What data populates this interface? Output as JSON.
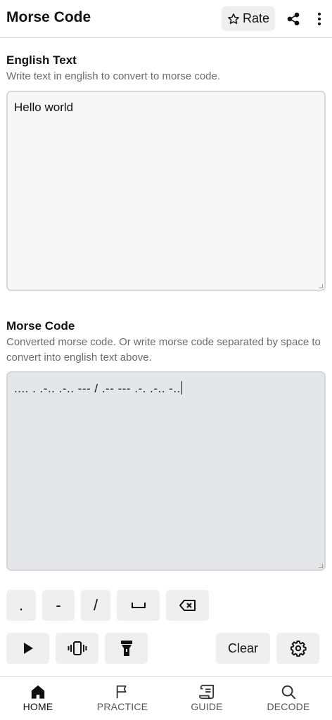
{
  "header": {
    "title": "Morse Code",
    "rate_label": "Rate"
  },
  "english": {
    "title": "English Text",
    "description": "Write text in english to convert to morse code.",
    "value": "Hello world"
  },
  "morse": {
    "title": "Morse Code",
    "description": "Converted morse code. Or write morse code separated by space to convert into english text above.",
    "value": ".... . .-.. .-.. --- / .-- --- .-. .-.. -.."
  },
  "keypad": {
    "dot": ".",
    "dash": "-",
    "slash": "/",
    "clear_label": "Clear"
  },
  "nav": {
    "items": [
      {
        "label": "HOME",
        "icon": "home-icon",
        "active": true
      },
      {
        "label": "PRACTICE",
        "icon": "flag-icon",
        "active": false
      },
      {
        "label": "GUIDE",
        "icon": "scroll-icon",
        "active": false
      },
      {
        "label": "DECODE",
        "icon": "search-icon",
        "active": false
      }
    ]
  },
  "colors": {
    "button_bg": "#efefef",
    "input_bg": "#f7f7f7",
    "morse_bg": "#e5e6e9",
    "muted_text": "#6b6b6b"
  }
}
